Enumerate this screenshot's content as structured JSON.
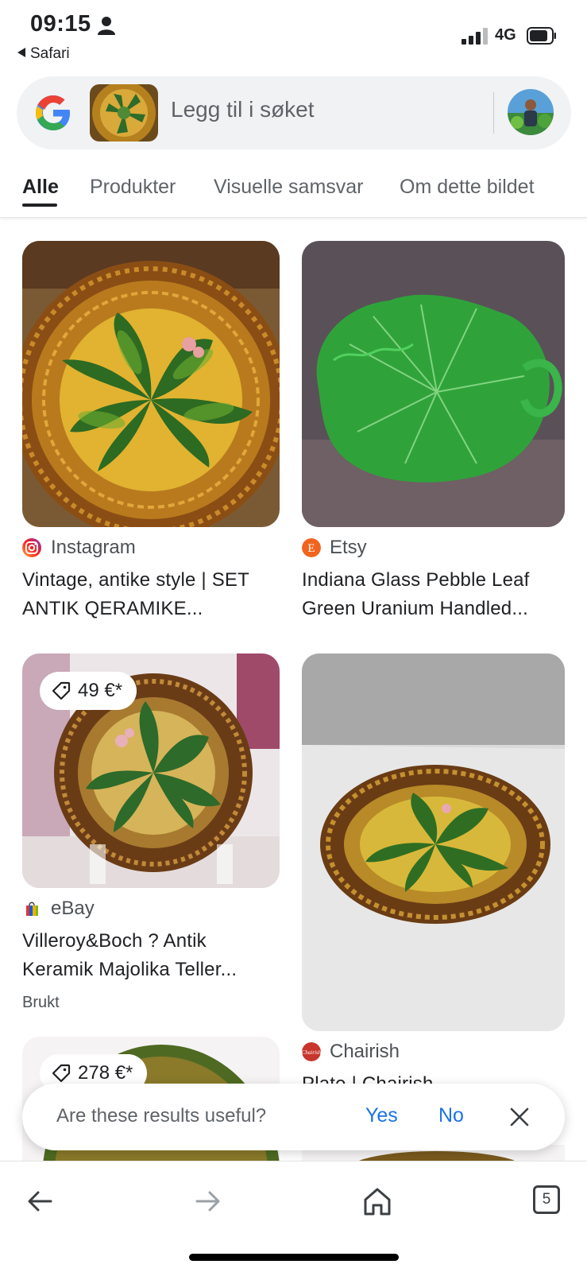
{
  "status_bar": {
    "time": "09:15",
    "back_app": "Safari",
    "network": "4G"
  },
  "search": {
    "placeholder": "Legg til i søket"
  },
  "tabs": [
    {
      "label": "Alle",
      "active": true
    },
    {
      "label": "Produkter"
    },
    {
      "label": "Visuelle samsvar"
    },
    {
      "label": "Om dette bildet"
    }
  ],
  "results": [
    {
      "source": "Instagram",
      "title_line1": "Vintage, antike style | SET",
      "title_line2": "ANTIK QERAMIKE..."
    },
    {
      "source": "Etsy",
      "title_line1": "Indiana Glass Pebble Leaf",
      "title_line2": "Green Uranium Handled..."
    },
    {
      "source": "eBay",
      "price": "49 €*",
      "title_line1": "Villeroy&Boch ? Antik",
      "title_line2": "Keramik Majolika Teller...",
      "condition": "Brukt"
    },
    {
      "source": "Chairish",
      "title_line1": "Plate | Chairish"
    },
    {
      "price": "278 €*"
    }
  ],
  "feedback": {
    "question": "Are these results useful?",
    "yes": "Yes",
    "no": "No"
  },
  "bottom_nav": {
    "tab_count": "5"
  },
  "colors": {
    "accent_blue": "#1a73e8",
    "search_bg": "#f0f2f4"
  },
  "icons": [
    "person-icon",
    "signal-icon",
    "battery-icon",
    "google-logo",
    "tag-icon",
    "close-icon",
    "back-arrow-icon",
    "forward-arrow-icon",
    "home-icon",
    "tabs-icon"
  ]
}
